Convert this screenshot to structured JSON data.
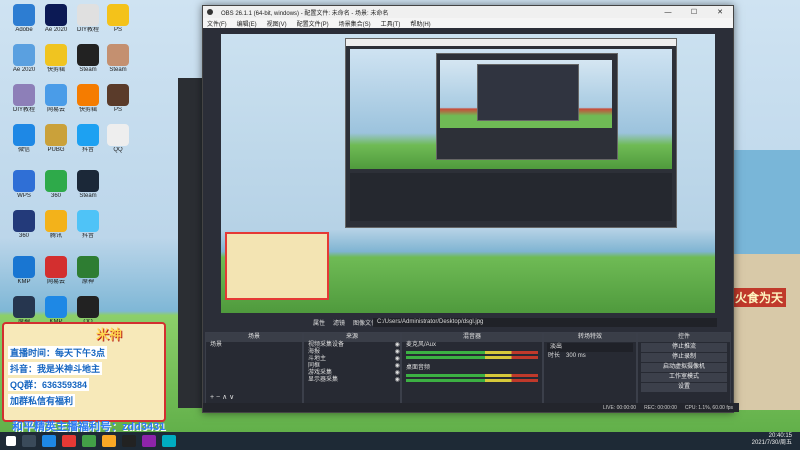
{
  "obs": {
    "title": "OBS 26.1.1 (64-bit, windows) - 配置文件: 未命名 - 场景: 未命名",
    "menu": [
      "文件(F)",
      "编辑(E)",
      "视图(V)",
      "配置文件(P)",
      "场景集合(S)",
      "工具(T)",
      "帮助(H)"
    ],
    "toolbar": [
      "属性",
      "滤镜",
      "图像文件"
    ],
    "file_path": "C:/Users/Administrator/Desktop/dsgl.jpg",
    "docks": {
      "scenes_title": "场景",
      "scenes": [
        "场景"
      ],
      "sources_title": "来源",
      "sources": [
        "视频采集设备",
        "海报",
        "斗地主",
        "同框",
        "游戏采集",
        "显示器采集"
      ],
      "mixer_title": "混音器",
      "mixer_tracks": [
        "麦克风/Aux",
        "桌面音频"
      ],
      "transitions_title": "转场特效",
      "transition_value": "淡出",
      "duration_label": "时长",
      "duration_value": "300 ms",
      "controls_title": "控件",
      "controls": [
        "停止推流",
        "停止录制",
        "启动虚拟摄像机",
        "工作室模式",
        "设置",
        "退出"
      ]
    },
    "status": [
      "LIVE: 00:00:00",
      "REC: 00:00:00",
      "CPU: 1.1%, 60.00 fps"
    ]
  },
  "overlay": {
    "brand": "米神",
    "line1": "直播时间：每天下午3点",
    "line2": "抖音：我是米神斗地主",
    "line3": "QQ群：636359384",
    "line4": "加群私信有福利"
  },
  "right_banner": "火食为天",
  "bottom_text": "和平精英主播福利号：zdd3431",
  "clock": {
    "time": "20:40:15",
    "date": "2021/7/30/周五"
  },
  "desktop_icons": [
    "Adobe",
    "Ae 2020",
    "DIY教程",
    "PS",
    "Steam",
    "快剪辑",
    "Steam",
    "微信",
    "QQ",
    "抖音",
    "PUBG",
    "WPS",
    "360",
    "网易云",
    "腾讯",
    "KMP",
    "原神"
  ]
}
